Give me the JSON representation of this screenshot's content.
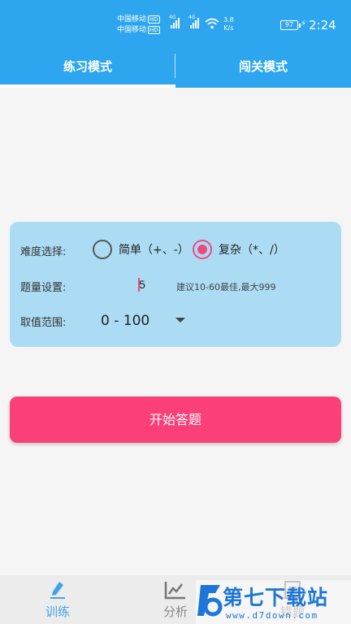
{
  "status_bar": {
    "carrier_1": "中国移动",
    "carrier_2": "中国移动",
    "hd_badge": "HD",
    "network_1": "4G",
    "network_2": "4G",
    "speed_value": "3.8",
    "speed_unit": "K/s",
    "battery": "97",
    "time": "2:24"
  },
  "tabs": [
    {
      "label": "练习模式",
      "active": true
    },
    {
      "label": "闯关模式",
      "active": false
    }
  ],
  "settings": {
    "difficulty_label": "难度选择:",
    "difficulty_options": [
      {
        "label": "简单（+、-）",
        "checked": false
      },
      {
        "label": "复杂（*、/）",
        "checked": true
      }
    ],
    "quantity_label": "题量设置:",
    "quantity_value": "5",
    "quantity_hint": "建议10-60最佳,最大999",
    "range_label": "取值范围:",
    "range_value": "0 - 100"
  },
  "start_button": "开始答题",
  "bottom_nav": [
    {
      "label": "训练",
      "icon": "pencil-icon",
      "active": true
    },
    {
      "label": "分析",
      "icon": "chart-icon",
      "active": false
    },
    {
      "label": "错题",
      "icon": "wrong-book-icon",
      "active": false
    }
  ],
  "watermark": {
    "name": "第七下载站",
    "url": "www.d7down.com"
  },
  "colors": {
    "primary": "#2ea6ef",
    "accent": "#fb3f79",
    "card": "#acdcf4",
    "nav_active": "#3fa3ec",
    "nav_inactive": "#888888"
  }
}
